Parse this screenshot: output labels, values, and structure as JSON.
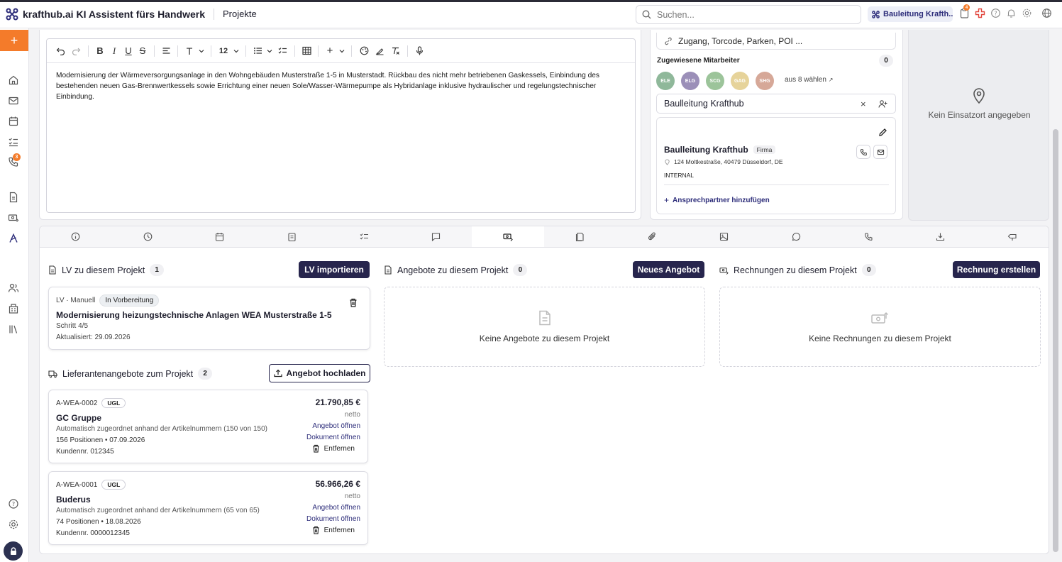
{
  "app": {
    "title": "krafthub.ai KI Assistent fürs Handwerk",
    "breadcrumb": "Projekte",
    "search_placeholder": "Suchen...",
    "company_chip": "Bauleitung Krafth...",
    "notif_badge": "4",
    "phone_badge": "3",
    "accent": "#f47b2a",
    "primary": "#27254d"
  },
  "editor": {
    "toolbar": {
      "font_size": "12"
    },
    "text": "Modernisierung der Wärmeversorgungsanlage in den Wohngebäuden Musterstraße 1-5 in Musterstadt. Rückbau des nicht mehr betriebenen Gaskessels, Einbindung des bestehenden neuen Gas-Brennwertkessels sowie Errichtung einer neuen Sole/Wasser-Wärmepumpe als Hybridanlage inklusive hydraulischer und regelungstechnischer Einbindung."
  },
  "site": {
    "access_placeholder": "Zugang, Torcode, Parken, POI ...",
    "assigned_label": "Zugewiesene Mitarbeiter",
    "assigned_count": "0",
    "employees": [
      {
        "initials": "ELE",
        "color": "#8fb89a"
      },
      {
        "initials": "ELG",
        "color": "#9b8fb8"
      },
      {
        "initials": "SCG",
        "color": "#9cc49a"
      },
      {
        "initials": "GAG",
        "color": "#e6d39a"
      },
      {
        "initials": "SHG",
        "color": "#d6a898"
      }
    ],
    "choose_link": "aus 8 wählen",
    "contact_value": "Baulleitung Krafthub",
    "contact": {
      "name": "Baulleitung Krafthub",
      "type_badge": "Firma",
      "address": "124 Moltkestraße, 40479 Düsseldorf, DE",
      "tag": "INTERNAL",
      "add_link": "Ansprechpartner hinzufügen"
    },
    "no_location": "Kein Einsatzort angegeben"
  },
  "lv_section": {
    "title": "LV zu diesem Projekt",
    "count": "1",
    "button": "LV importieren",
    "card": {
      "source": "LV · Manuell",
      "status": "In Vorbereitung",
      "title": "Modernisierung heizungstechnische Anlagen WEA Musterstraße 1-5",
      "step": "Schritt 4/5",
      "updated": "Aktualisiert: 29.09.2026"
    }
  },
  "offers_section": {
    "title": "Angebote zu diesem Projekt",
    "count": "0",
    "button": "Neues Angebot",
    "empty": "Keine Angebote zu diesem Projekt"
  },
  "invoices_section": {
    "title": "Rechnungen zu diesem Projekt",
    "count": "0",
    "button": "Rechnung erstellen",
    "empty": "Keine Rechnungen zu diesem Projekt"
  },
  "supplier_section": {
    "title": "Lieferantenangebote zum Projekt",
    "count": "2",
    "button": "Angebot hochladen",
    "offers": [
      {
        "id": "A-WEA-0002",
        "tag": "UGL",
        "supplier": "GC Gruppe",
        "match": "Automatisch zugeordnet anhand der Artikelnummern (150 von 150)",
        "positions": "156 Positionen • 07.09.2026",
        "customer": "Kundennr. 012345",
        "amount": "21.790,85 €",
        "net": "netto",
        "open_offer": "Angebot öffnen",
        "open_doc": "Dokument öffnen",
        "remove": "Entfernen"
      },
      {
        "id": "A-WEA-0001",
        "tag": "UGL",
        "supplier": "Buderus",
        "match": "Automatisch zugeordnet anhand der Artikelnummern (65 von 65)",
        "positions": "74 Positionen • 18.08.2026",
        "customer": "Kundennr. 0000012345",
        "amount": "56.966,26 €",
        "net": "netto",
        "open_offer": "Angebot öffnen",
        "open_doc": "Dokument öffnen",
        "remove": "Entfernen"
      }
    ]
  }
}
